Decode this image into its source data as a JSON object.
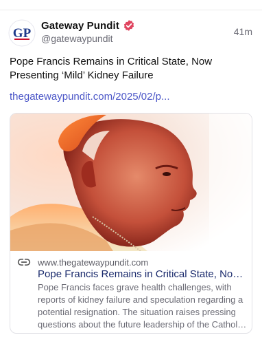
{
  "post": {
    "author_name": "Gateway Pundit",
    "author_handle": "@gatewaypundit",
    "timestamp": "41m",
    "text": "Pope Francis Remains in Critical State, Now Presenting ‘Mild’ Kidney Failure",
    "link_text": "thegatewaypundit.com/2025/02/p...",
    "avatar_letters": "GP"
  },
  "card": {
    "domain": "www.thegatewaypundit.com",
    "title": "Pope Francis Remains in Critical State, Now Presenting ‘Mild’ Kidney Failure",
    "description": "Pope Francis faces grave health challenges, with reports of kidney failure and speculation regarding a potential resignation. The situation raises pressing questions about the future leadership of the Catholic Church."
  },
  "colors": {
    "verified_badge": "#e0445f",
    "link": "#4a55c7",
    "card_title": "#1a2a6c",
    "avatar_blue": "#1e3a8a"
  },
  "icons": {
    "verified": "verified-badge-icon",
    "link": "link-chain-icon"
  }
}
